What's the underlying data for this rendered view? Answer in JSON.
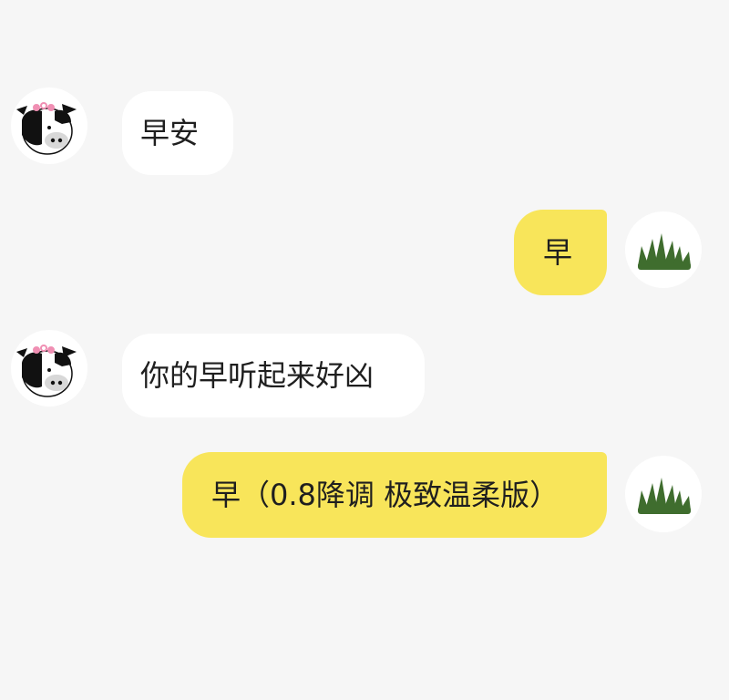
{
  "messages": [
    {
      "side": "left",
      "avatar": "cow-avatar",
      "text": "早安"
    },
    {
      "side": "right",
      "avatar": "grass-avatar",
      "text": "早"
    },
    {
      "side": "left",
      "avatar": "cow-avatar",
      "text": "你的早听起来好凶"
    },
    {
      "side": "right",
      "avatar": "grass-avatar",
      "text": "早（0.8降调 极致温柔版）"
    }
  ],
  "colors": {
    "background": "#f6f6f6",
    "incoming_bubble": "#ffffff",
    "outgoing_bubble": "#f8e55a",
    "text": "#1f1f1f",
    "grass": "#3f6d2e"
  }
}
